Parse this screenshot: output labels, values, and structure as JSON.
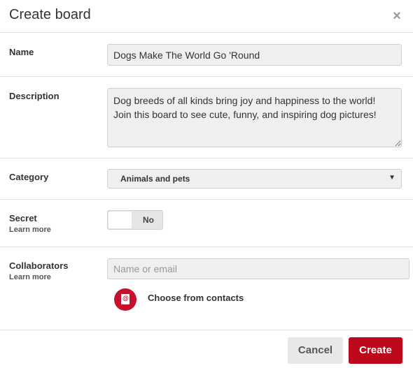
{
  "dialog": {
    "title": "Create board",
    "close_symbol": "×"
  },
  "name": {
    "label": "Name",
    "value": "Dogs Make The World Go 'Round"
  },
  "description": {
    "label": "Description",
    "value": "Dog breeds of all kinds bring joy and happiness to the world! Join this board to see cute, funny, and inspiring dog pictures!"
  },
  "category": {
    "label": "Category",
    "selected": "Animals and pets",
    "arrow": "▼"
  },
  "secret": {
    "label": "Secret",
    "learn_more": "Learn more",
    "toggle_state": "No"
  },
  "collaborators": {
    "label": "Collaborators",
    "learn_more": "Learn more",
    "placeholder": "Name or email",
    "contacts_label": "Choose from contacts",
    "contacts_icon": "address-book-icon"
  },
  "footer": {
    "cancel_label": "Cancel",
    "create_label": "Create"
  },
  "colors": {
    "accent": "#bd081c",
    "field_bg": "#efefef",
    "divider": "#e1e1e1"
  }
}
